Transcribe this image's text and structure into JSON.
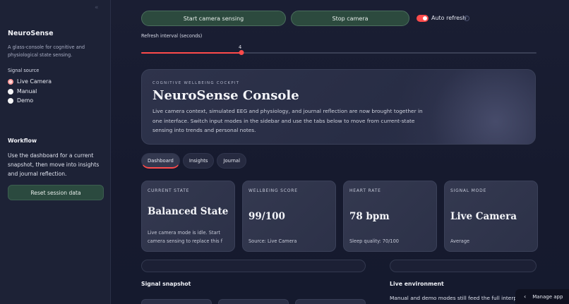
{
  "sidebar": {
    "collapse_glyph": "«",
    "title": "NeuroSense",
    "description": "A glass-console for cognitive and physiological state sensing.",
    "signal_source_label": "Signal source",
    "signal_options": [
      {
        "label": "Live Camera",
        "selected": true
      },
      {
        "label": "Manual",
        "selected": false
      },
      {
        "label": "Demo",
        "selected": false
      }
    ],
    "workflow_title": "Workflow",
    "workflow_text": "Use the dashboard for a current snapshot, then move into insights and journal reflection.",
    "reset_label": "Reset session data"
  },
  "controls": {
    "start_label": "Start camera sensing",
    "stop_label": "Stop camera",
    "auto_refresh_label": "Auto refresh",
    "auto_refresh_on": true,
    "help_glyph": "?",
    "slider_label": "Refresh interval (seconds)",
    "slider_value": "4",
    "slider_fraction": 0.254
  },
  "hero": {
    "eyebrow": "COGNITIVE WELLBEING COCKPIT",
    "title": "NeuroSense Console",
    "text": "Live camera context, simulated EEG and physiology, and journal reflection are now brought together in one interface. Switch input modes in the sidebar and use the tabs below to move from current-state sensing into trends and personal notes."
  },
  "tabs": [
    {
      "label": "Dashboard",
      "active": true
    },
    {
      "label": "Insights",
      "active": false
    },
    {
      "label": "Journal",
      "active": false
    }
  ],
  "metrics": [
    {
      "label": "CURRENT STATE",
      "value": "Balanced State",
      "sub": "Live camera mode is idle. Start camera sensing to replace this f"
    },
    {
      "label": "WELLBEING SCORE",
      "value": "99/100",
      "sub": "Source: Live Camera"
    },
    {
      "label": "HEART RATE",
      "value": "78 bpm",
      "sub": "Sleep quality: 70/100"
    },
    {
      "label": "SIGNAL MODE",
      "value": "Live Camera",
      "sub": "Average"
    }
  ],
  "sections": {
    "snapshot_title": "Signal snapshot",
    "environment_title": "Live environment",
    "environment_text": "Manual and demo modes still feed the full interpretation"
  },
  "manage_app": {
    "label": "Manage app",
    "chevron": "‹"
  },
  "colors": {
    "accent": "#ff4b4b",
    "button_green": "#2c4a3e",
    "background": "#161a2e",
    "sidebar": "#1d2236"
  }
}
